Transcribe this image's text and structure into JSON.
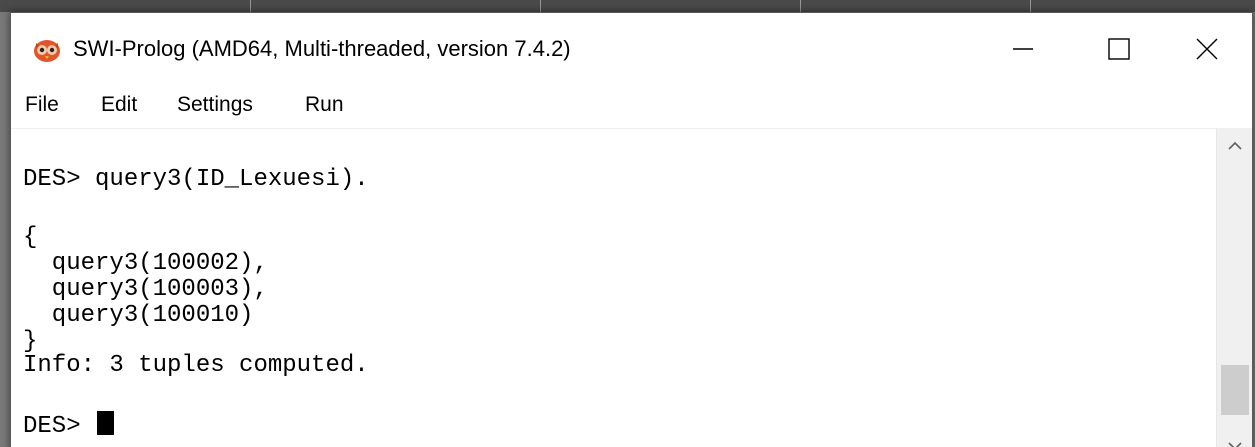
{
  "window": {
    "title": "SWI-Prolog (AMD64, Multi-threaded, version 7.4.2)",
    "app_icon": "swi-prolog-owl-icon",
    "controls": {
      "minimize": "minimize-icon",
      "maximize": "maximize-icon",
      "close": "close-icon"
    }
  },
  "menu": {
    "file": "File",
    "edit": "Edit",
    "settings": "Settings",
    "run": "Run"
  },
  "console": {
    "lines": [
      "DES> query3(ID_Lexuesi).",
      "",
      "{",
      "  query3(100002),",
      "  query3(100003),",
      "  query3(100010)",
      "}",
      "Info: 3 tuples computed.",
      "",
      "DES> "
    ]
  },
  "scrollbar": {
    "up": "chevron-up-icon",
    "down": "chevron-down-icon"
  },
  "colors": {
    "title_bg": "#ffffff",
    "console_bg": "#ffffff",
    "text": "#000000",
    "scroll_track": "#f0f0f0",
    "scroll_thumb": "#cdcdcd"
  }
}
